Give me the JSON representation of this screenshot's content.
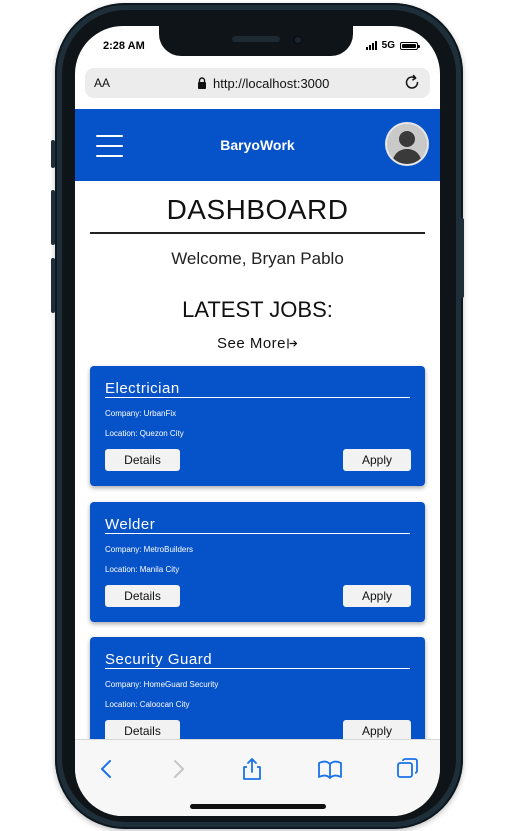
{
  "status_bar": {
    "time": "2:28 AM",
    "network": "5G"
  },
  "browser": {
    "text_size_label": "AA",
    "url": "http://localhost:3000"
  },
  "header": {
    "brand": "BaryoWork"
  },
  "dashboard": {
    "title": "DASHBOARD",
    "welcome": "Welcome, Bryan Pablo",
    "latest_jobs_title": "LATEST JOBS:",
    "see_more": "See More"
  },
  "jobs": [
    {
      "title": "Electrician",
      "company": "Company: UrbanFix",
      "location": "Location: Quezon City",
      "details_label": "Details",
      "apply_label": "Apply"
    },
    {
      "title": "Welder",
      "company": "Company: MetroBuilders",
      "location": "Location: Manila City",
      "details_label": "Details",
      "apply_label": "Apply"
    },
    {
      "title": "Security Guard",
      "company": "Company: HomeGuard Security",
      "location": "Location: Caloocan City",
      "details_label": "Details",
      "apply_label": "Apply"
    }
  ],
  "colors": {
    "brand_blue": "#0652c9",
    "toolbar_blue": "#1a73e8"
  },
  "icons": [
    "lock-icon",
    "reload-icon",
    "hamburger-menu-icon",
    "avatar",
    "see-more-arrow-icon",
    "back-icon",
    "forward-icon",
    "share-icon",
    "bookmarks-icon",
    "tabs-icon"
  ]
}
